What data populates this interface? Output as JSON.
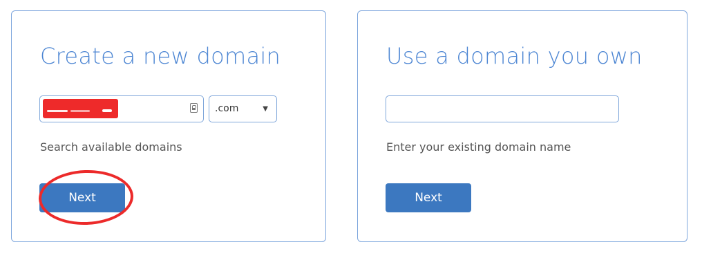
{
  "left_card": {
    "title": "Create a new domain",
    "domain_input": {
      "value": "",
      "placeholder": ""
    },
    "tld_select": {
      "selected": ".com",
      "arrow": "▼"
    },
    "helper": "Search available domains",
    "next_label": "Next",
    "annotation_color": "#ec2a2a"
  },
  "right_card": {
    "title": "Use a domain you own",
    "domain_input": {
      "value": "",
      "placeholder": ""
    },
    "helper": "Enter your existing domain name",
    "next_label": "Next"
  },
  "colors": {
    "accent": "#4d86d3",
    "button": "#3c78c0",
    "border": "#7da6dd"
  }
}
